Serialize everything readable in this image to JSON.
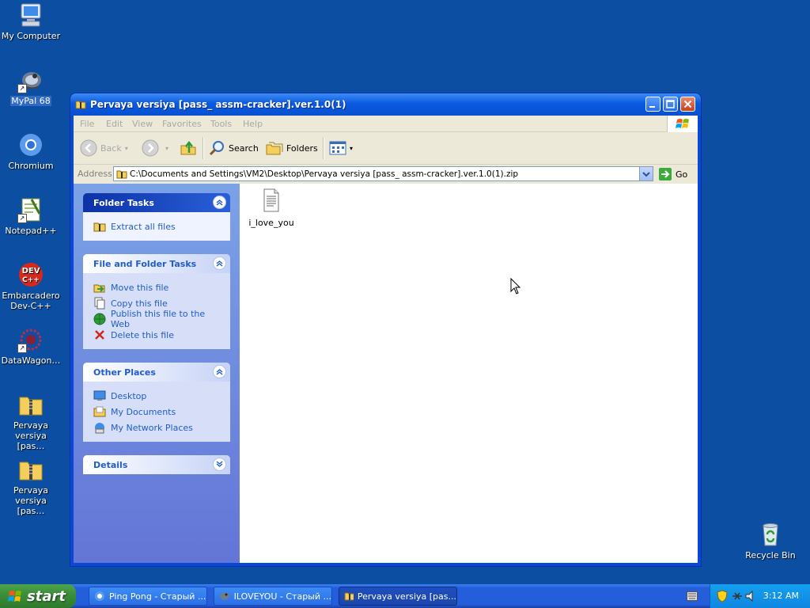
{
  "desktop": {
    "icons": [
      {
        "label": "My Computer",
        "icon": "my-computer-icon"
      },
      {
        "label": "MyPal 68",
        "icon": "mypal-icon"
      },
      {
        "label": "Chromium",
        "icon": "chromium-icon"
      },
      {
        "label": "Notepad++",
        "icon": "notepad-plus-plus-icon"
      },
      {
        "label": "Embarcadero Dev-C++",
        "icon": "devcpp-icon"
      },
      {
        "label": "DataWagon…",
        "icon": "datawagon-icon"
      },
      {
        "label": "Pervaya versiya [pas…",
        "icon": "zip-folder-icon"
      },
      {
        "label": "Pervaya versiya [pas…",
        "icon": "zip-folder-icon"
      },
      {
        "label": "Recycle Bin",
        "icon": "recycle-bin-icon"
      }
    ]
  },
  "window": {
    "title": "Pervaya versiya [pass_ assm-cracker].ver.1.0(1)",
    "menu": [
      "File",
      "Edit",
      "View",
      "Favorites",
      "Tools",
      "Help"
    ],
    "toolbar": {
      "back": "Back",
      "search": "Search",
      "folders": "Folders"
    },
    "address": {
      "label": "Address",
      "value": "C:\\Documents and Settings\\VM2\\Desktop\\Pervaya versiya [pass_ assm-cracker].ver.1.0(1).zip",
      "go": "Go"
    },
    "panels": {
      "folder_tasks": {
        "title": "Folder Tasks",
        "tasks": [
          "Extract all files"
        ]
      },
      "file_folder_tasks": {
        "title": "File and Folder Tasks",
        "tasks": [
          "Move this file",
          "Copy this file",
          "Publish this file to the Web",
          "Delete this file"
        ]
      },
      "other_places": {
        "title": "Other Places",
        "places": [
          "Desktop",
          "My Documents",
          "My Network Places"
        ]
      },
      "details": {
        "title": "Details"
      }
    },
    "files": [
      {
        "name": "i_love_you",
        "icon": "text-file-icon"
      }
    ]
  },
  "taskbar": {
    "start": "start",
    "tasks": [
      {
        "label": "Ping Pong - Старый ...",
        "icon": "browser-icon"
      },
      {
        "label": "ILOVEYOU - Старый ...",
        "icon": "mypal-icon"
      },
      {
        "label": "Pervaya versiya [pas...",
        "icon": "zip-folder-icon"
      }
    ],
    "clock": "3:12 AM"
  },
  "colors": {
    "desktop": "#0b4ea2",
    "titlebar": "#0a5ae0",
    "link": "#215dc6",
    "start": "#3c8f3a"
  }
}
